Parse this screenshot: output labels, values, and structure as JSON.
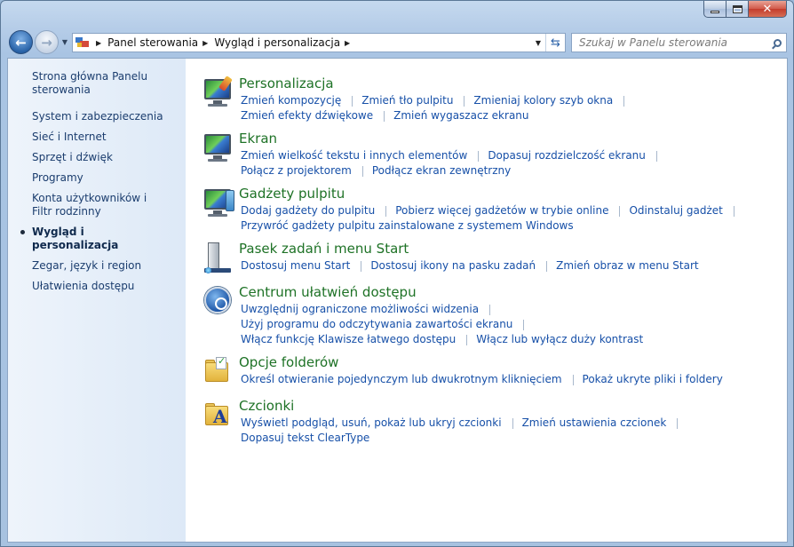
{
  "window": {
    "address": {
      "crumbs": [
        "Panel sterowania",
        "Wygląd i personalizacja"
      ]
    },
    "search": {
      "placeholder": "Szukaj w Panelu sterowania"
    }
  },
  "sidebar": {
    "home": "Strona główna Panelu sterowania",
    "items": [
      "System i zabezpieczenia",
      "Sieć i Internet",
      "Sprzęt i dźwięk",
      "Programy",
      "Konta użytkowników i Filtr rodzinny",
      "Wygląd i personalizacja",
      "Zegar, język i region",
      "Ułatwienia dostępu"
    ]
  },
  "categories": [
    {
      "title": "Personalizacja",
      "icon": "personalization-icon",
      "links": [
        "Zmień kompozycję",
        "Zmień tło pulpitu",
        "Zmieniaj kolory szyb okna",
        "Zmień efekty dźwiękowe",
        "Zmień wygaszacz ekranu"
      ]
    },
    {
      "title": "Ekran",
      "icon": "display-icon",
      "links": [
        "Zmień wielkość tekstu i innych elementów",
        "Dopasuj rozdzielczość ekranu",
        "Połącz z projektorem",
        "Podłącz ekran zewnętrzny"
      ]
    },
    {
      "title": "Gadżety pulpitu",
      "icon": "desktop-gadgets-icon",
      "links": [
        "Dodaj gadżety do pulpitu",
        "Pobierz więcej gadżetów w trybie online",
        "Odinstaluj gadżet",
        "Przywróć gadżety pulpitu zainstalowane z systemem Windows"
      ]
    },
    {
      "title": "Pasek zadań i menu Start",
      "icon": "taskbar-icon",
      "links": [
        "Dostosuj menu Start",
        "Dostosuj ikony na pasku zadań",
        "Zmień obraz w menu Start"
      ]
    },
    {
      "title": "Centrum ułatwień dostępu",
      "icon": "ease-of-access-icon",
      "links": [
        "Uwzględnij ograniczone możliwości widzenia",
        "Użyj programu do odczytywania zawartości ekranu",
        "Włącz funkcję Klawisze łatwego dostępu",
        "Włącz lub wyłącz duży kontrast"
      ]
    },
    {
      "title": "Opcje folderów",
      "icon": "folder-options-icon",
      "links": [
        "Określ otwieranie pojedynczym lub dwukrotnym kliknięciem",
        "Pokaż ukryte pliki i foldery"
      ]
    },
    {
      "title": "Czcionki",
      "icon": "fonts-icon",
      "links": [
        "Wyświetl podgląd, usuń, pokaż lub ukryj czcionki",
        "Zmień ustawienia czcionek",
        "Dopasuj tekst ClearType"
      ]
    }
  ]
}
